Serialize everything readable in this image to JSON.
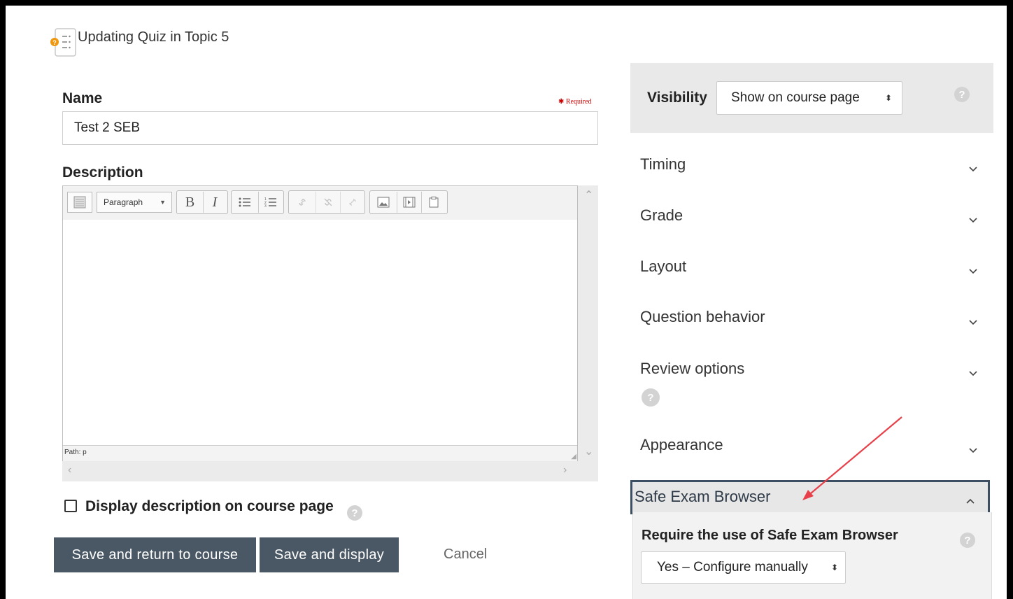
{
  "header": {
    "title": "Updating Quiz in Topic 5",
    "icon": "quiz-icon"
  },
  "form": {
    "name_label": "Name",
    "required_label": "Required",
    "name_value": "Test 2 SEB",
    "description_label": "Description",
    "editor": {
      "paragraph_select": "Paragraph",
      "path_text": "Path: p",
      "toolbar_icons": [
        "toolbar-toggle-icon",
        "bold-icon",
        "italic-icon",
        "unordered-list-icon",
        "ordered-list-icon",
        "link-icon",
        "unlink-icon",
        "anchor-icon",
        "image-icon",
        "media-icon",
        "manage-files-icon"
      ]
    },
    "display_description_label": "Display description on course page",
    "display_description_checked": false,
    "buttons": {
      "save_return": "Save and return to course",
      "save_display": "Save and display",
      "cancel": "Cancel"
    }
  },
  "sidebar": {
    "visibility_label": "Visibility",
    "visibility_value": "Show on course page",
    "sections": [
      {
        "label": "Timing"
      },
      {
        "label": "Grade"
      },
      {
        "label": "Layout"
      },
      {
        "label": "Question behavior"
      },
      {
        "label": "Review options"
      },
      {
        "label": "Appearance"
      }
    ],
    "seb": {
      "title": "Safe Exam Browser",
      "require_label": "Require the use of Safe Exam Browser",
      "require_value": "Yes – Configure manually"
    }
  },
  "colors": {
    "button_bg": "#4a5866",
    "required_red": "#cc0000",
    "annotation_arrow": "#e8404a",
    "focus_border": "#3d4f63"
  }
}
